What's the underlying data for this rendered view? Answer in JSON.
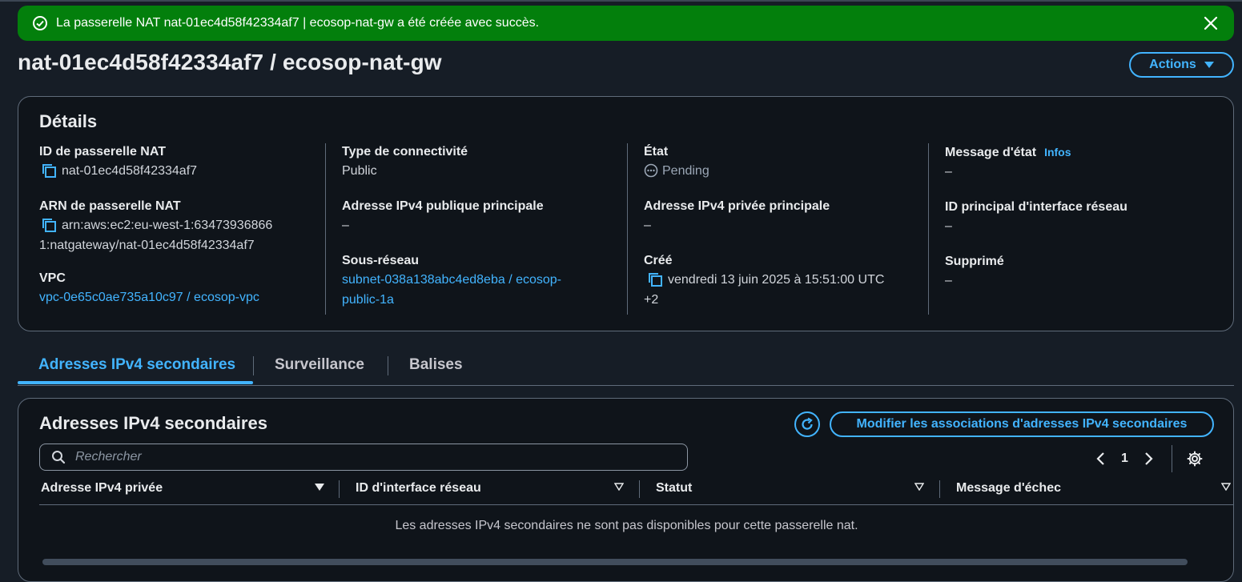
{
  "flash": {
    "message": "La passerelle NAT nat-01ec4d58f42334af7 | ecosop-nat-gw a été créée avec succès."
  },
  "header": {
    "title": "nat-01ec4d58f42334af7 / ecosop-nat-gw",
    "actions_label": "Actions"
  },
  "details": {
    "heading": "Détails",
    "nat_id_label": "ID de passerelle NAT",
    "nat_id": "nat-01ec4d58f42334af7",
    "arn_label": "ARN de passerelle NAT",
    "arn_line1": "arn:aws:ec2:eu-west-1:63473936866",
    "arn_line2": "1:natgateway/nat-01ec4d58f42334af7",
    "vpc_label": "VPC",
    "vpc": "vpc-0e65c0ae735a10c97 / ecosop-vpc",
    "connectivity_label": "Type de connectivité",
    "connectivity": "Public",
    "public_ip_label": "Adresse IPv4 publique principale",
    "public_ip": "–",
    "subnet_label": "Sous-réseau",
    "subnet_line1": "subnet-038a138abc4ed8eba / ecosop-",
    "subnet_line2": "public-1a",
    "state_label": "État",
    "state": "Pending",
    "private_ip_label": "Adresse IPv4 privée principale",
    "private_ip": "–",
    "created_label": "Créé",
    "created_line1": "vendredi 13 juin 2025 à 15:51:00 UTC",
    "created_line2": "+2",
    "state_message_label": "Message d'état",
    "infos": "Infos",
    "state_message": "–",
    "eni_label": "ID principal d'interface réseau",
    "eni": "–",
    "deleted_label": "Supprimé",
    "deleted": "–"
  },
  "tabs": [
    {
      "label": "Adresses IPv4 secondaires",
      "active": true
    },
    {
      "label": "Surveillance",
      "active": false
    },
    {
      "label": "Balises",
      "active": false
    }
  ],
  "secondary": {
    "heading": "Adresses IPv4 secondaires",
    "modify_label": "Modifier les associations d'adresses IPv4 secondaires",
    "search_placeholder": "Rechercher",
    "page": "1",
    "columns": [
      "Adresse IPv4 privée",
      "ID d'interface réseau",
      "Statut",
      "Message d'échec"
    ],
    "empty_message": "Les adresses IPv4 secondaires ne sont pas disponibles pour cette passerelle nat."
  },
  "colors": {
    "success": "#037f0c",
    "accent": "#42b4ff",
    "background": "#161d26"
  }
}
